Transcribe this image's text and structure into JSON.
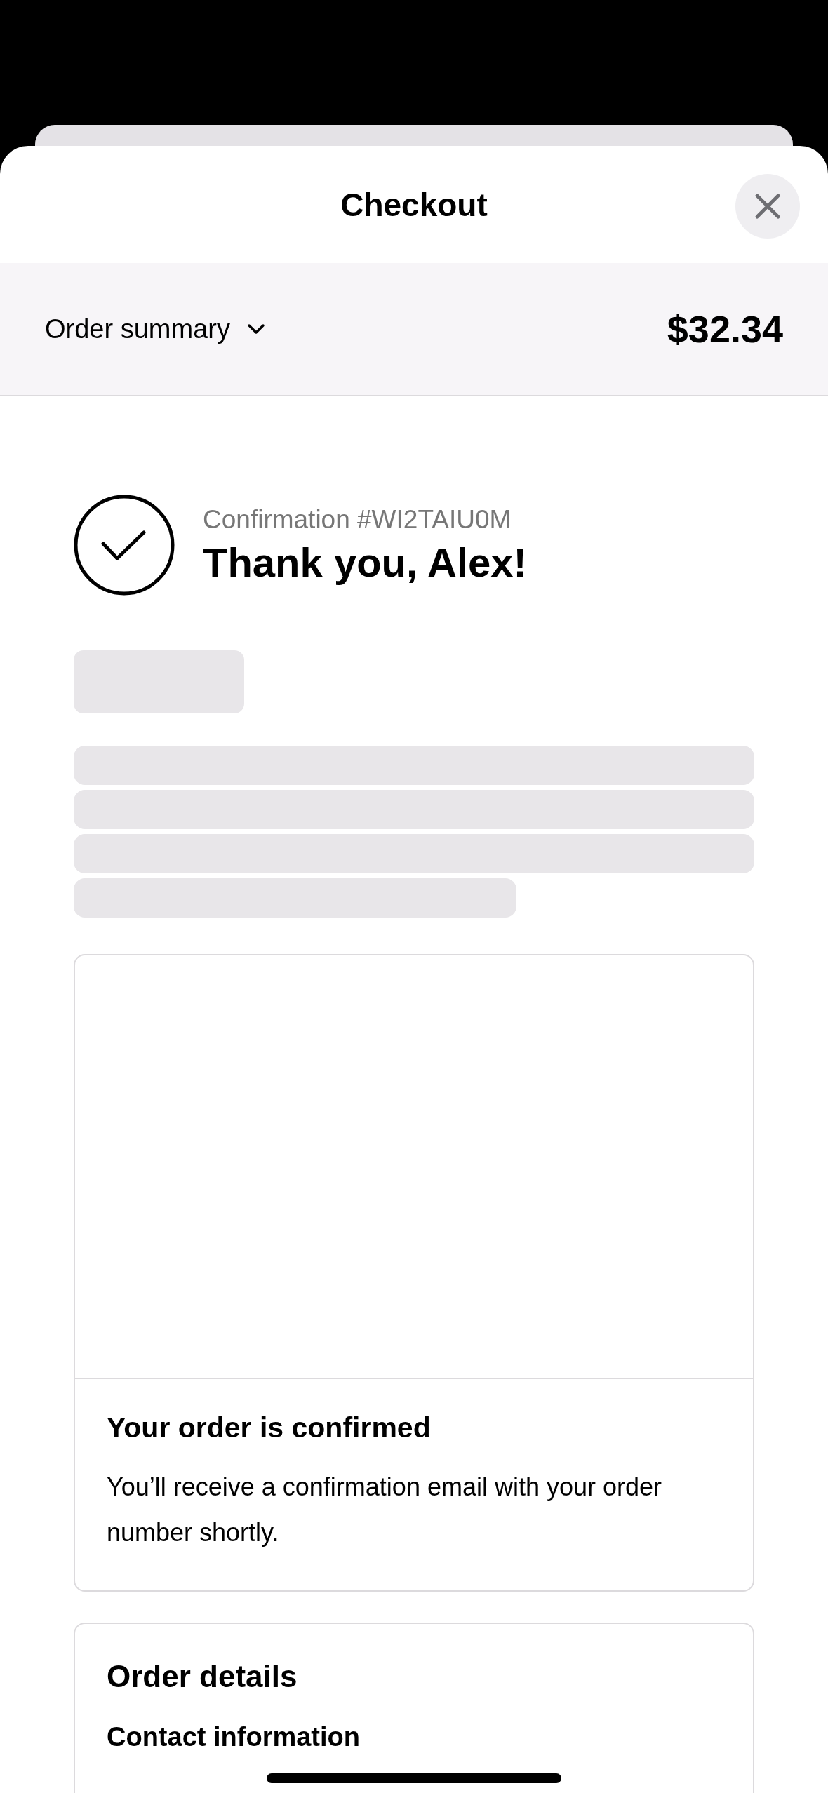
{
  "header": {
    "title": "Checkout"
  },
  "summary": {
    "label": "Order summary",
    "expanded": false,
    "total": "$32.34"
  },
  "confirmation": {
    "number": "Confirmation #WI2TAIU0M",
    "title": "Thank you, Alex!"
  },
  "status_card": {
    "title": "Your order is confirmed",
    "text": "You’ll receive a confirmation email with your order number shortly."
  },
  "details_card": {
    "title": "Order details",
    "section": "Contact information"
  }
}
